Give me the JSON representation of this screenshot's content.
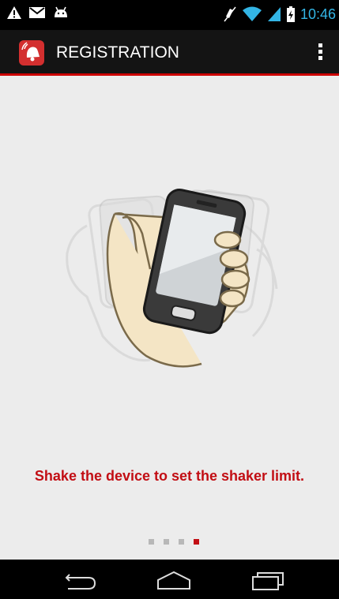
{
  "status_bar": {
    "time": "10:46",
    "left_icons": [
      "warning-icon",
      "gmail-icon",
      "android-icon"
    ],
    "right_icons": [
      "mute-icon",
      "wifi-icon",
      "signal-icon",
      "battery-charging-icon"
    ],
    "clock_color": "#33b5e5"
  },
  "action_bar": {
    "title": "REGISTRATION",
    "app_icon": "alarm-bell-icon",
    "accent_color": "#cc0000"
  },
  "main": {
    "illustration": "hand-shaking-phone-icon",
    "instruction": "Shake the device to set the shaker limit.",
    "instruction_color": "#c20e14"
  },
  "pager": {
    "total": 4,
    "current": 4
  },
  "nav_bar": {
    "buttons": [
      "back-icon",
      "home-icon",
      "recent-apps-icon"
    ]
  }
}
